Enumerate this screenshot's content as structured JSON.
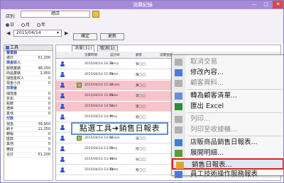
{
  "window": {
    "title": "消費紀錄",
    "minimize": "—",
    "maximize": "□",
    "close": "✕"
  },
  "store": {
    "label": "店別:",
    "value": "總店"
  },
  "radios": [
    {
      "label": "日",
      "checked": true
    },
    {
      "label": "月",
      "checked": false
    },
    {
      "label": "年",
      "checked": false
    }
  ],
  "nav": {
    "prev": "◀",
    "next": "▶"
  },
  "date": {
    "value": "2015/04/14",
    "dropdown": "▾"
  },
  "buttons": {
    "confirm": "確定",
    "refresh": "更新"
  },
  "tool_button": "工具",
  "tabs": [
    {
      "label": "消單(31)"
    },
    {
      "label": "取消(1)"
    }
  ],
  "columns": [
    "消費時間",
    "設計師",
    "顧客",
    "消費金額"
  ],
  "summary": {
    "header": "營業額",
    "rows": [
      {
        "label": "營業額",
        "value": "",
        "section": true
      },
      {
        "label": "總計",
        "value": "51,200"
      },
      {
        "label": "現金收入",
        "value": "",
        "section": true
      },
      {
        "label": "服務業績",
        "value": "48,250"
      },
      {
        "label": "商品業績",
        "value": "2,950"
      },
      {
        "label": "儲值金收入",
        "value": "0"
      },
      {
        "label": "現金小計",
        "value": "0"
      },
      {
        "label": "非現金",
        "value": "",
        "section": true
      },
      {
        "label": "儲值金",
        "value": "0"
      },
      {
        "label": "折扣",
        "value": "0"
      },
      {
        "label": "點數",
        "value": "0"
      },
      {
        "label": "禮券",
        "value": "0"
      },
      {
        "label": "其他",
        "value": "0"
      },
      {
        "label": "付款",
        "value": "",
        "section": true
      },
      {
        "label": "現金",
        "value": "39,950"
      },
      {
        "label": "刷卡",
        "value": "11,250"
      },
      {
        "label": "轉帳",
        "value": "0"
      },
      {
        "label": "匯款",
        "value": "0"
      },
      {
        "label": "其他",
        "value": "0"
      },
      {
        "label": "應收",
        "value": "0"
      },
      {
        "label": "合計",
        "value": "51,200"
      }
    ]
  },
  "rows": [
    {
      "time": "2015/04/14 16:31",
      "designer": "Berry",
      "customer": "郭◯◯",
      "pink": false,
      "gift": false
    },
    {
      "time": "2015/04/14 15:50",
      "designer": "Peter",
      "customer": "陳◯◯",
      "pink": false,
      "gift": false
    },
    {
      "time": "2015/04/14 15:20",
      "designer": "Vivian",
      "customer": "黃◯◯",
      "pink": true,
      "gift": true
    },
    {
      "time": "2015/04/14 15:06",
      "designer": "Peter",
      "customer": "李◯◯",
      "pink": true,
      "gift": false
    },
    {
      "time": "2015/04/14 14:52",
      "designer": "Hart",
      "customer": "張◯◯",
      "pink": true,
      "gift": false
    },
    {
      "time": "2015/04/14 14:40",
      "designer": "Amy",
      "customer": "劉◯◯",
      "pink": false,
      "gift": false
    },
    {
      "time": "2015/04/14 14:24",
      "designer": "Kate",
      "customer": "林◯◯",
      "pink": false,
      "gift": false
    },
    {
      "time": "2015/04/14 14:06",
      "designer": "Vivian",
      "customer": "吳◯◯",
      "pink": false,
      "gift": true
    },
    {
      "time": "2015/04/14 13:52",
      "designer": "Amy",
      "customer": "周◯◯",
      "pink": false,
      "gift": false
    },
    {
      "time": "2015/04/14 13:34",
      "designer": "Kate",
      "customer": "徐◯◯",
      "pink": false,
      "gift": false
    },
    {
      "time": "2015/04/14 13:18",
      "designer": "Peter",
      "customer": "蔡◯◯",
      "pink": false,
      "gift": false
    }
  ],
  "callout": "點選工具➔銷售日報表",
  "menu": [
    {
      "label": "取消交易",
      "disabled": true,
      "icon": "cancel-icon"
    },
    {
      "label": "修改內容...",
      "disabled": false,
      "icon": "edit-icon"
    },
    {
      "label": "顧客資料...",
      "disabled": true,
      "icon": "customer-icon"
    },
    {
      "label": "轉為顧客清單...",
      "disabled": false,
      "icon": "list-icon"
    },
    {
      "label": "匯出 Excel",
      "disabled": false,
      "icon": "excel-icon"
    },
    {
      "label": "列印...",
      "disabled": true,
      "icon": "print-icon"
    },
    {
      "label": "列印至收據機...",
      "disabled": true,
      "icon": "receipt-icon"
    },
    {
      "label": "店販商品銷售日報表...",
      "disabled": false,
      "icon": "report-icon"
    },
    {
      "label": "展開明細...",
      "disabled": false,
      "icon": "expand-icon"
    },
    {
      "label": "銷售日報表...",
      "disabled": false,
      "icon": "sales-report-icon",
      "highlighted": true
    },
    {
      "label": "員工技術操作服務報表",
      "disabled": false,
      "icon": "staff-report-icon"
    }
  ],
  "colors": {
    "titlebar": "#a68ad8",
    "pink_row": "#f7c4cc",
    "highlight_border": "#d9231f",
    "callout_border": "#5f8fcf"
  }
}
